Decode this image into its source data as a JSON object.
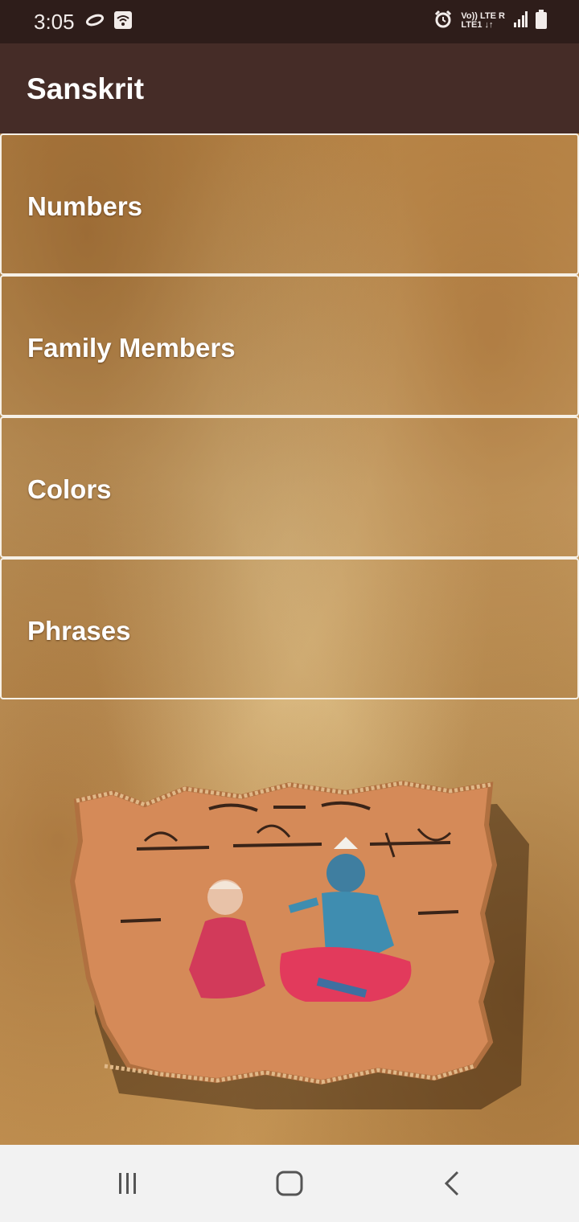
{
  "status_bar": {
    "time": "3:05",
    "icons": [
      "sync-icon",
      "wifi-icon",
      "alarm-icon",
      "signal-icon",
      "battery-icon"
    ],
    "network_line1": "Vo)) LTE R",
    "network_line2": "LTE1 ↓↑"
  },
  "app_bar": {
    "title": "Sanskrit"
  },
  "menu": {
    "items": [
      {
        "label": "Numbers"
      },
      {
        "label": "Family Members"
      },
      {
        "label": "Colors"
      },
      {
        "label": "Phrases"
      }
    ]
  },
  "illustration": {
    "icon": "manuscript-illustration"
  },
  "nav_bar": {
    "buttons": [
      "recent-apps-icon",
      "home-icon",
      "back-icon"
    ]
  },
  "colors": {
    "status_bar": "#2e1d1a",
    "app_bar": "#452c27",
    "menu_border": "#f6f0e6",
    "nav_bar": "#f2f2f2"
  }
}
